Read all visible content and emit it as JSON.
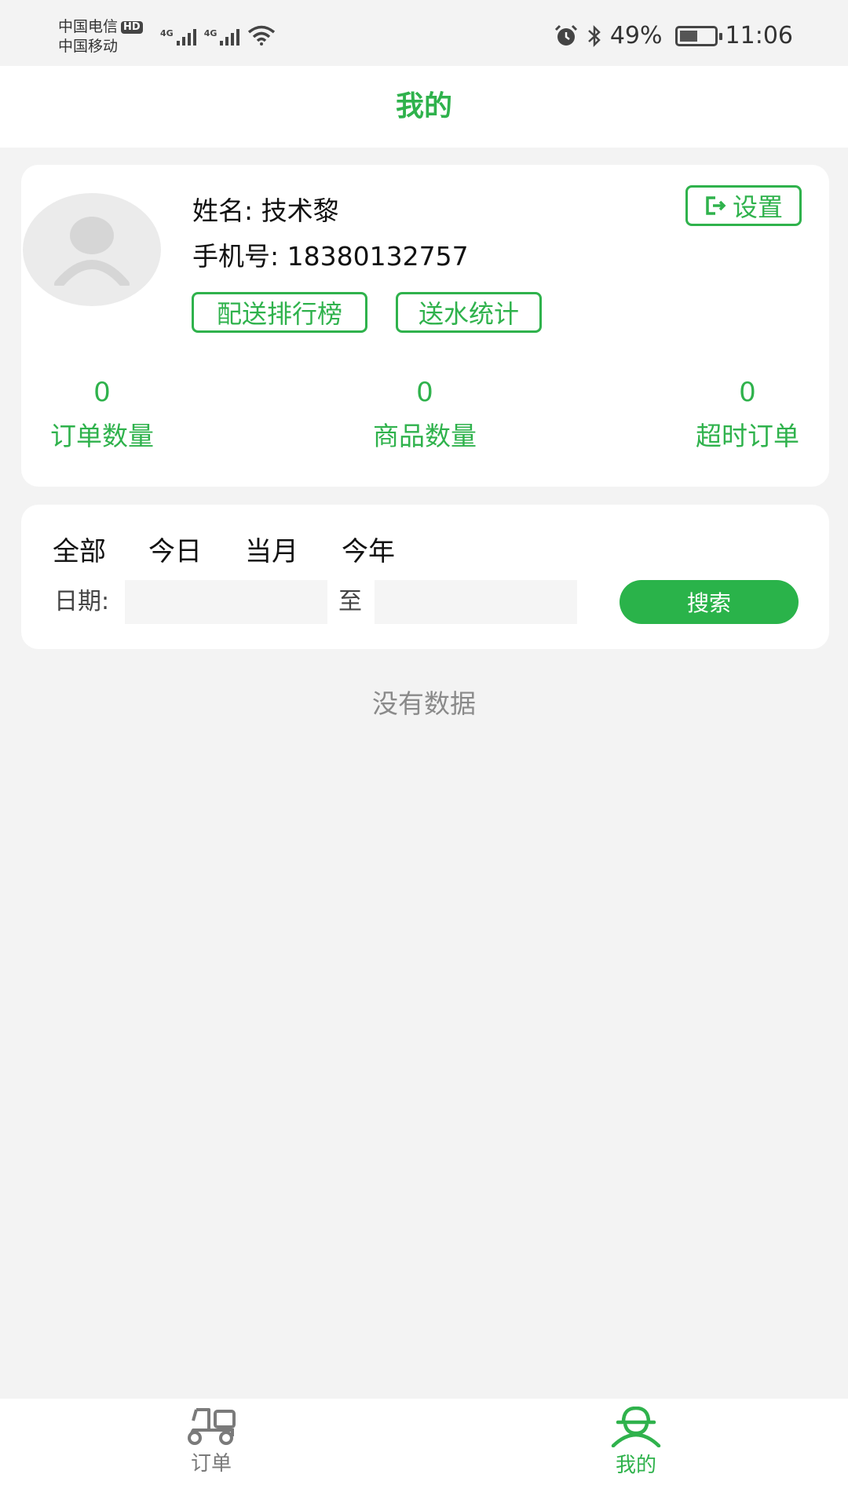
{
  "status_bar": {
    "carrier_1": "中国电信",
    "hd_badge": "HD",
    "carrier_2": "中国移动",
    "network_1": "4G",
    "network_2": "4G",
    "battery": "49%",
    "time": "11:06"
  },
  "header": {
    "title": "我的"
  },
  "profile": {
    "name_label": "姓名:",
    "name": "技术黎",
    "phone_label": "手机号:",
    "phone": "18380132757",
    "settings_label": "设置",
    "ranking_label": "配送排行榜",
    "stats_label": "送水统计"
  },
  "stats": [
    {
      "value": "0",
      "label": "订单数量"
    },
    {
      "value": "0",
      "label": "商品数量"
    },
    {
      "value": "0",
      "label": "超时订单"
    }
  ],
  "filter": {
    "tabs": [
      "全部",
      "今日",
      "当月",
      "今年"
    ],
    "date_label": "日期:",
    "date_from": "",
    "date_to": "",
    "separator": "至",
    "search_label": "搜索"
  },
  "empty_message": "没有数据",
  "bottom_nav": {
    "items": [
      {
        "label": "订单",
        "icon": "scooter-icon",
        "active": false
      },
      {
        "label": "我的",
        "icon": "courier-icon",
        "active": true
      }
    ]
  },
  "colors": {
    "accent": "#2fb24c",
    "background": "#f3f3f3",
    "inactive": "#7a7a7a"
  }
}
